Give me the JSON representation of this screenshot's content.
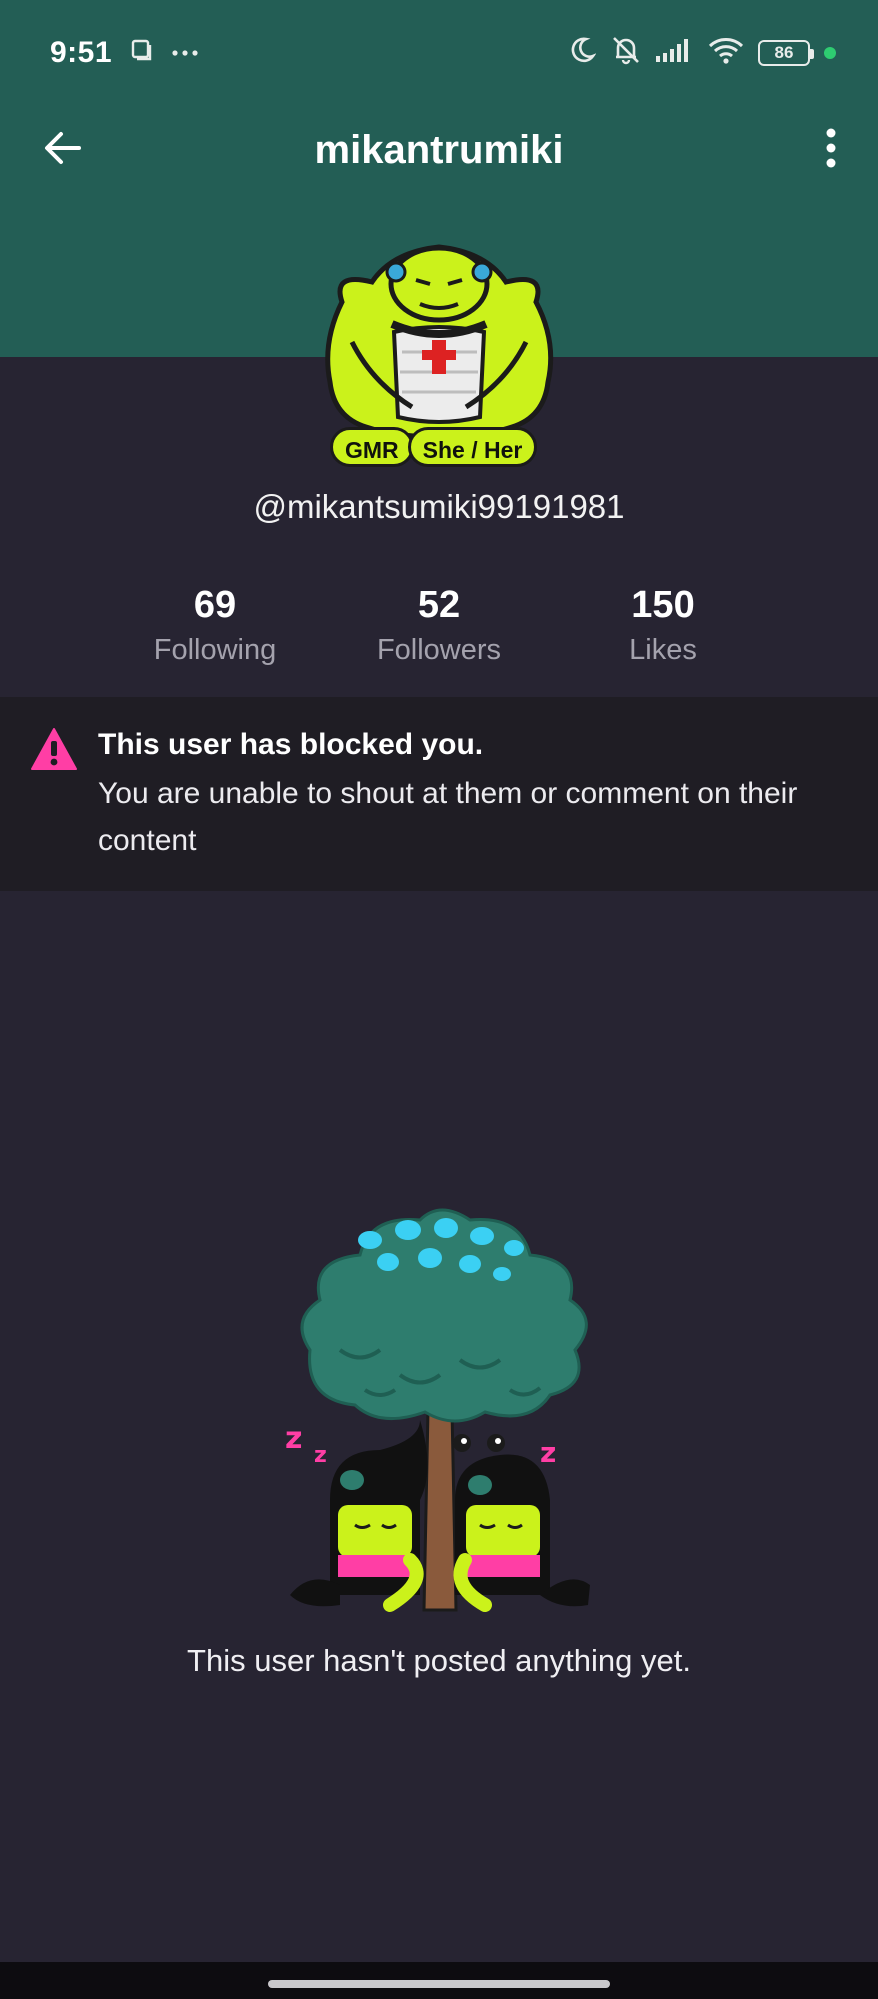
{
  "status_bar": {
    "time": "9:51",
    "battery": "86",
    "icons": [
      "recent-apps-icon",
      "more-dots-icon",
      "moon-icon",
      "bell-off-icon",
      "signal-icon",
      "wifi-icon",
      "battery-icon",
      "green-dot-icon"
    ]
  },
  "header": {
    "title": "mikantrumiki",
    "back_icon": "arrow-left-icon",
    "menu_icon": "more-vertical-icon",
    "color": "#235e55"
  },
  "profile": {
    "badges": [
      "GMR",
      "She / Her"
    ],
    "handle": "@mikantsumiki99191981",
    "badge_color": "#cbf21b"
  },
  "stats": [
    {
      "value": "69",
      "label": "Following"
    },
    {
      "value": "52",
      "label": "Followers"
    },
    {
      "value": "150",
      "label": "Likes"
    }
  ],
  "blocked_notice": {
    "title": "This user has blocked you.",
    "body": "You are unable to shout at them or comment on their content",
    "icon": "warning-triangle-icon",
    "accent": "#ff3ea5"
  },
  "empty_state": {
    "message": "This user hasn't posted anything yet.",
    "illustration": "sleeping-creatures-under-tree"
  }
}
